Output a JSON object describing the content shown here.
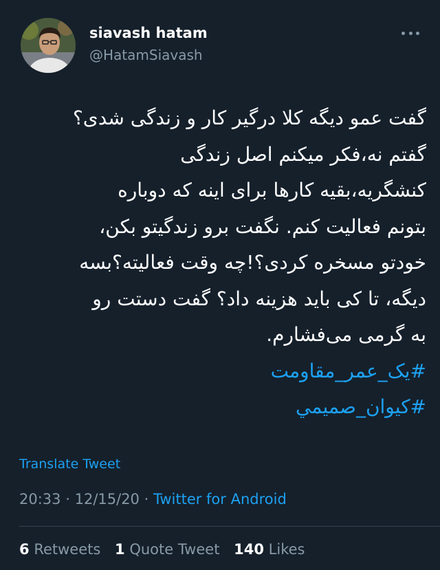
{
  "author": {
    "name": "siavash hatam",
    "handle": "@HatamSiavash"
  },
  "tweet": {
    "lines": [
      "گفت عمو دیگه کلا درگیر کار و زندگی شدی؟",
      "گفتم نه،فکر میکنم اصل زندگی",
      "کنشگریه،بقیه کارها برای اینه که دوباره",
      "بتونم فعالیت کنم. نگفت برو زندگیتو بکن،",
      "خودتو مسخره کردی؟!چه وقت فعالیته؟بسه",
      "دیگه، تا کی باید هزینه داد؟ گفت دستت رو",
      "به گرمی می‌فشارم."
    ],
    "hashtags": [
      "#یک_عمر_مقاومت",
      "#كيوان_صميمي"
    ],
    "translate_label": "Translate Tweet",
    "time": "20:33",
    "date": "12/15/20",
    "separator": "·",
    "source": "Twitter for Android"
  },
  "stats": {
    "retweets_count": "6",
    "retweets_label": "Retweets",
    "quotes_count": "1",
    "quotes_label": "Quote Tweet",
    "likes_count": "140",
    "likes_label": "Likes"
  },
  "colors": {
    "background": "#15202b",
    "accent": "#1da1f2",
    "secondary_text": "#8899a6"
  },
  "icons": {
    "more": "more-dots-icon"
  }
}
